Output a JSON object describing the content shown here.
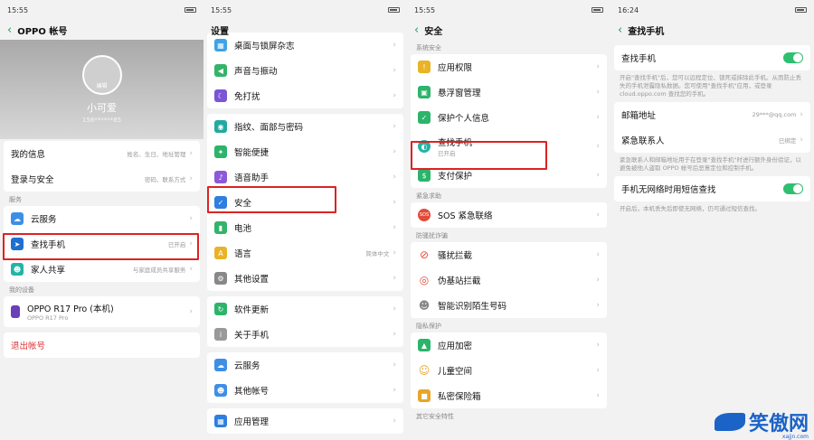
{
  "p1": {
    "time": "15:55",
    "title": "OPPO 帐号",
    "avatar_label": "编辑",
    "name": "小可爱",
    "phone": "158******85",
    "rows1": [
      {
        "label": "我的信息",
        "val": "姓名、生日、地址管理"
      },
      {
        "label": "登录与安全",
        "val": "密码、联系方式"
      }
    ],
    "sec_service": "服务",
    "services": [
      {
        "label": "云服务",
        "val": ""
      },
      {
        "label": "查找手机",
        "val": "已开启"
      },
      {
        "label": "家人共享",
        "val": "与家庭成员共享服务"
      }
    ],
    "sec_device": "我的设备",
    "device": "OPPO R17 Pro (本机)",
    "device_sub": "OPPO R17 Pro",
    "logout": "退出帐号"
  },
  "p2": {
    "time": "15:55",
    "title": "设置",
    "items": [
      "桌面与锁屏杂志",
      "声音与振动",
      "免打扰",
      "指纹、面部与密码",
      "智能便捷",
      "语音助手",
      "安全",
      "电池",
      "语言",
      "其他设置",
      "软件更新",
      "关于手机",
      "云服务",
      "其他帐号",
      "应用管理"
    ],
    "lang_val": "简体中文"
  },
  "p3": {
    "time": "15:55",
    "title": "安全",
    "sec1": "系统安全",
    "items1": [
      "应用权限",
      "悬浮窗管理",
      "保护个人信息"
    ],
    "find": "查找手机",
    "find_sub": "已开启",
    "pay": "支付保护",
    "sec2": "紧急求助",
    "sos": "SOS 紧急联络",
    "sec3": "防骚扰诈骗",
    "items3": [
      "骚扰拦截",
      "伪基站拦截",
      "智能识别陌生号码"
    ],
    "sec4": "隐私保护",
    "items4": [
      "应用加密",
      "儿童空间",
      "私密保险箱"
    ],
    "sec5": "其它安全特性"
  },
  "p4": {
    "time": "16:24",
    "title": "查找手机",
    "find_label": "查找手机",
    "find_desc": "开启\"查找手机\"后，您可以远程定位、锁死或抹除此手机。从而防止丢失的手机泄露隐私数据。您可使用\"查找手机\"应用，或登录 cloud.oppo.com 查找您的手机。",
    "email_label": "邮箱地址",
    "email_val": "29***@qq.com",
    "contact_label": "紧急联系人",
    "contact_val": "已绑定",
    "contact_desc": "紧急联系人和邮箱地址用于在登录\"查找手机\"时进行额外身份验证，以避免被他人盗取 OPPO 帐号后恶意定位和控制手机。",
    "sms_label": "手机无网络时用短信查找",
    "sms_desc": "开启后，本机丢失后即使无网络，仍可通过短信查找。"
  },
  "watermark": {
    "text": "笑傲网",
    "url": "xajjn.com"
  },
  "colors": {
    "accent": "#2a9d5c",
    "highlight": "#dd2222",
    "toggle": "#2fbf71"
  }
}
